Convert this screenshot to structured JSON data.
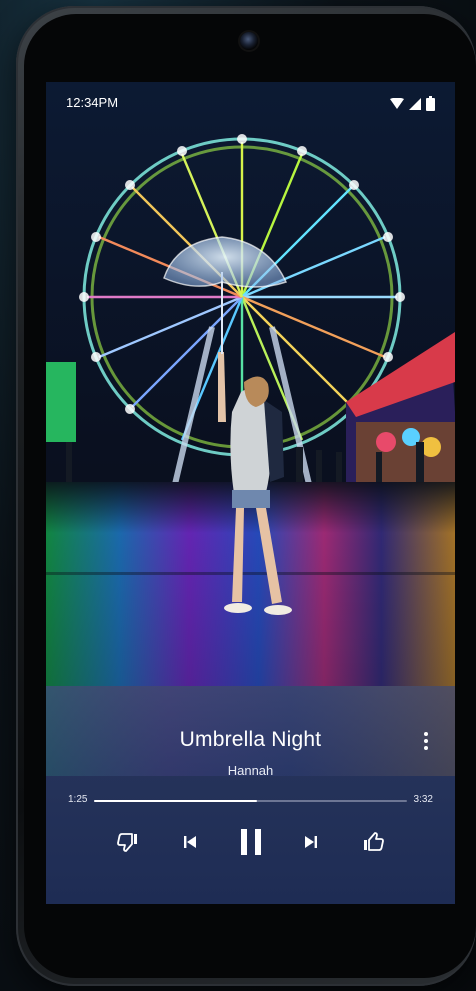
{
  "status_bar": {
    "time": "12:34PM",
    "icons": [
      "wifi-icon",
      "cell-signal-icon",
      "battery-icon"
    ]
  },
  "now_playing": {
    "title": "Umbrella Night",
    "artist": "Hannah",
    "elapsed": "1:25",
    "duration": "3:32",
    "progress": 0.52
  },
  "controls": [
    "thumbs-down-icon",
    "previous-icon",
    "pause-icon",
    "next-icon",
    "thumbs-up-icon",
    "more-vert-icon"
  ],
  "colors": {
    "panel": "#2b3a66",
    "text": "#ffffff",
    "seek_track": "#9aa1b6"
  }
}
